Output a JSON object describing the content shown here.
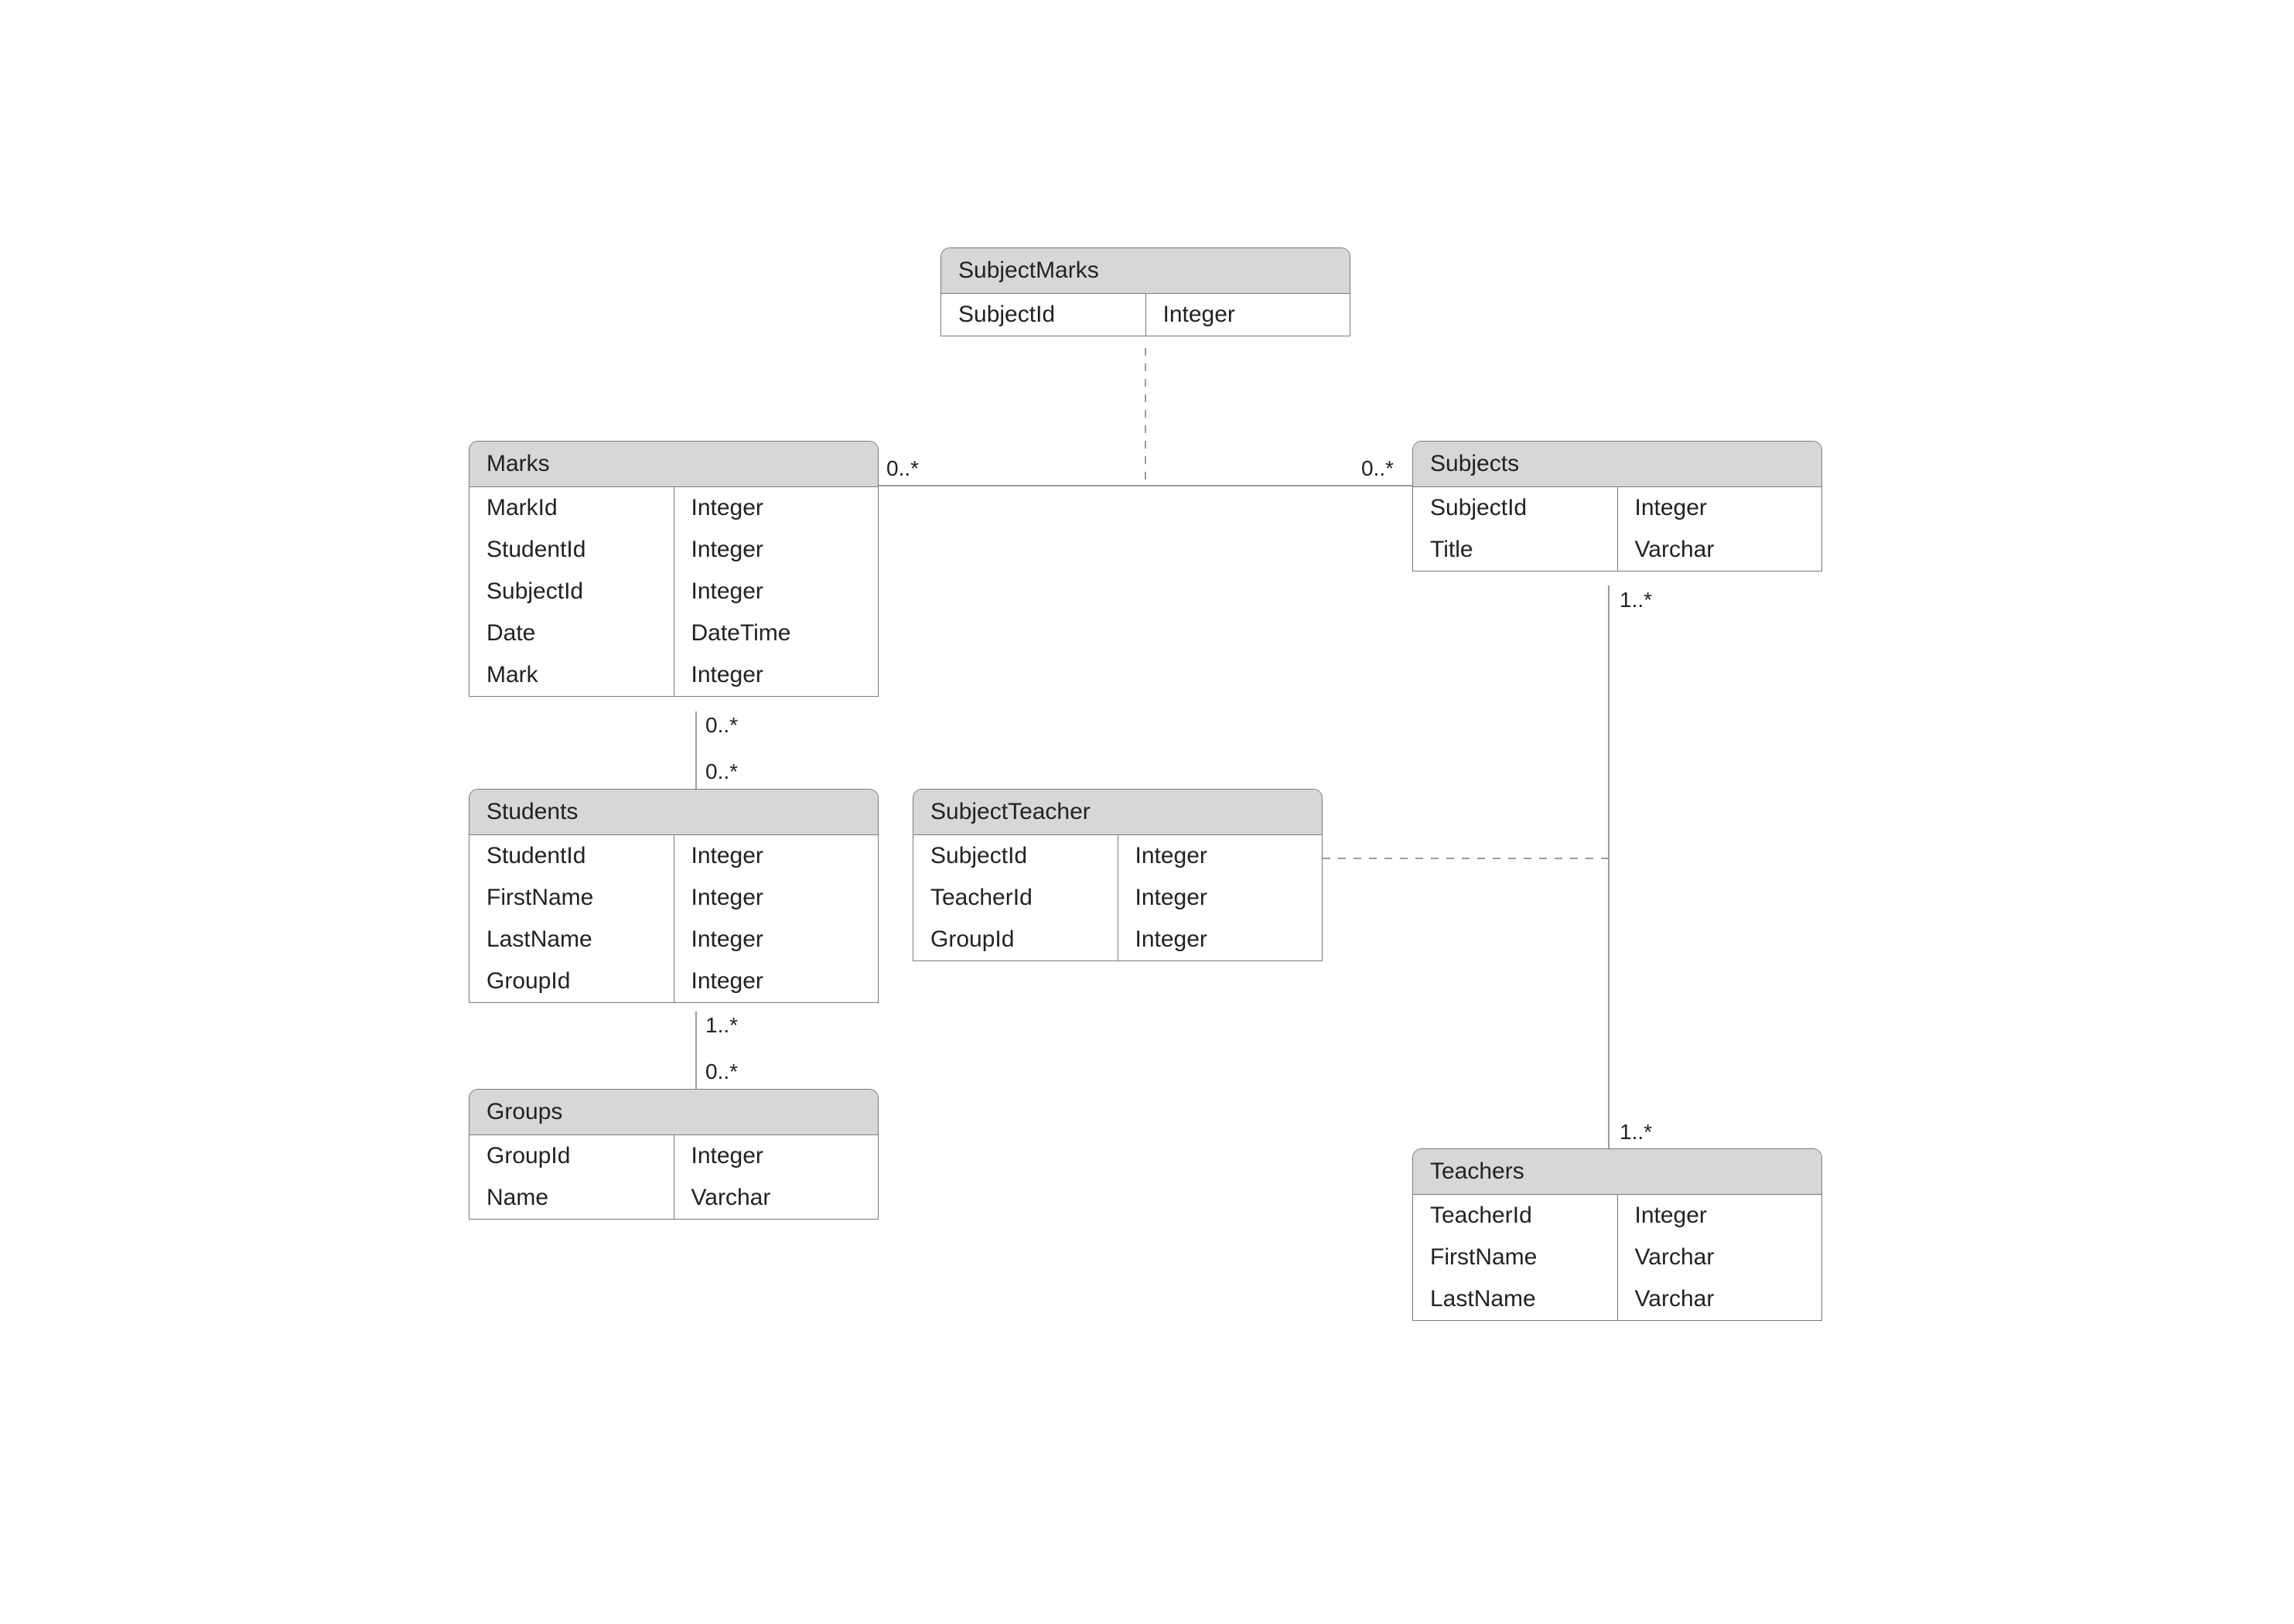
{
  "entities": {
    "subjectMarks": {
      "title": "SubjectMarks",
      "rows": [
        {
          "name": "SubjectId",
          "type": "Integer"
        }
      ]
    },
    "marks": {
      "title": "Marks",
      "rows": [
        {
          "name": "MarkId",
          "type": "Integer"
        },
        {
          "name": "StudentId",
          "type": "Integer"
        },
        {
          "name": "SubjectId",
          "type": "Integer"
        },
        {
          "name": "Date",
          "type": "DateTime"
        },
        {
          "name": "Mark",
          "type": "Integer"
        }
      ]
    },
    "subjects": {
      "title": "Subjects",
      "rows": [
        {
          "name": "SubjectId",
          "type": "Integer"
        },
        {
          "name": "Title",
          "type": "Varchar"
        }
      ]
    },
    "students": {
      "title": "Students",
      "rows": [
        {
          "name": "StudentId",
          "type": "Integer"
        },
        {
          "name": "FirstName",
          "type": "Integer"
        },
        {
          "name": "LastName",
          "type": "Integer"
        },
        {
          "name": "GroupId",
          "type": "Integer"
        }
      ]
    },
    "subjectTeacher": {
      "title": "SubjectTeacher",
      "rows": [
        {
          "name": "SubjectId",
          "type": "Integer"
        },
        {
          "name": "TeacherId",
          "type": "Integer"
        },
        {
          "name": "GroupId",
          "type": "Integer"
        }
      ]
    },
    "groups": {
      "title": "Groups",
      "rows": [
        {
          "name": "GroupId",
          "type": "Integer"
        },
        {
          "name": "Name",
          "type": "Varchar"
        }
      ]
    },
    "teachers": {
      "title": "Teachers",
      "rows": [
        {
          "name": "TeacherId",
          "type": "Integer"
        },
        {
          "name": "FirstName",
          "type": "Varchar"
        },
        {
          "name": "LastName",
          "type": "Varchar"
        }
      ]
    }
  },
  "labels": {
    "marks_to_subjects_left": "0..*",
    "marks_to_subjects_right": "0..*",
    "subjects_to_teachers_top": "1..*",
    "subjects_to_teachers_bottom": "1..*",
    "marks_to_students_top": "0..*",
    "marks_to_students_bottom": "0..*",
    "students_to_groups_top": "1..*",
    "students_to_groups_bottom": "0..*"
  }
}
